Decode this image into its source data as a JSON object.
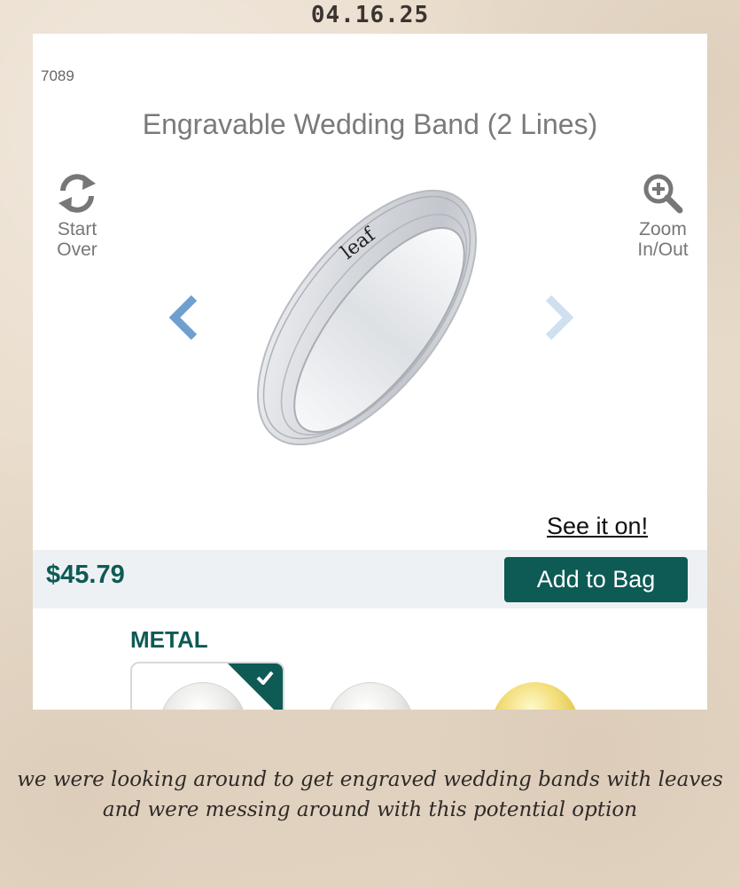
{
  "scrapbook": {
    "date": "04.16.25",
    "caption_line1": "we were looking around to get engraved wedding bands with leaves",
    "caption_line2": "and were messing around with this potential option"
  },
  "product": {
    "id": "7089",
    "title": "Engravable Wedding Band (2 Lines)",
    "engraving_text": "leaf",
    "price": "$45.79"
  },
  "tools": {
    "start_over_line1": "Start",
    "start_over_line2": "Over",
    "zoom_line1": "Zoom",
    "zoom_line2": "In/Out"
  },
  "actions": {
    "see_it_on": "See it on!",
    "add_to_bag": "Add to Bag"
  },
  "metal": {
    "heading": "METAL",
    "options": [
      {
        "name": "white-metal-1",
        "color": "#e9e9e6",
        "selected": true
      },
      {
        "name": "white-metal-2",
        "color": "#ebebe8",
        "selected": false
      },
      {
        "name": "yellow-gold",
        "color": "#f3df7c",
        "selected": false
      }
    ]
  },
  "colors": {
    "brand": "#0e5a55",
    "nav_arrow_active": "#6f9fcf",
    "nav_arrow_inactive": "#cfe0f0",
    "paper_background": "#e9dccb"
  },
  "icons": {
    "start_over": "refresh-icon",
    "zoom": "zoom-in-icon",
    "prev": "chevron-left-icon",
    "next": "chevron-right-icon",
    "selected": "check-icon"
  }
}
